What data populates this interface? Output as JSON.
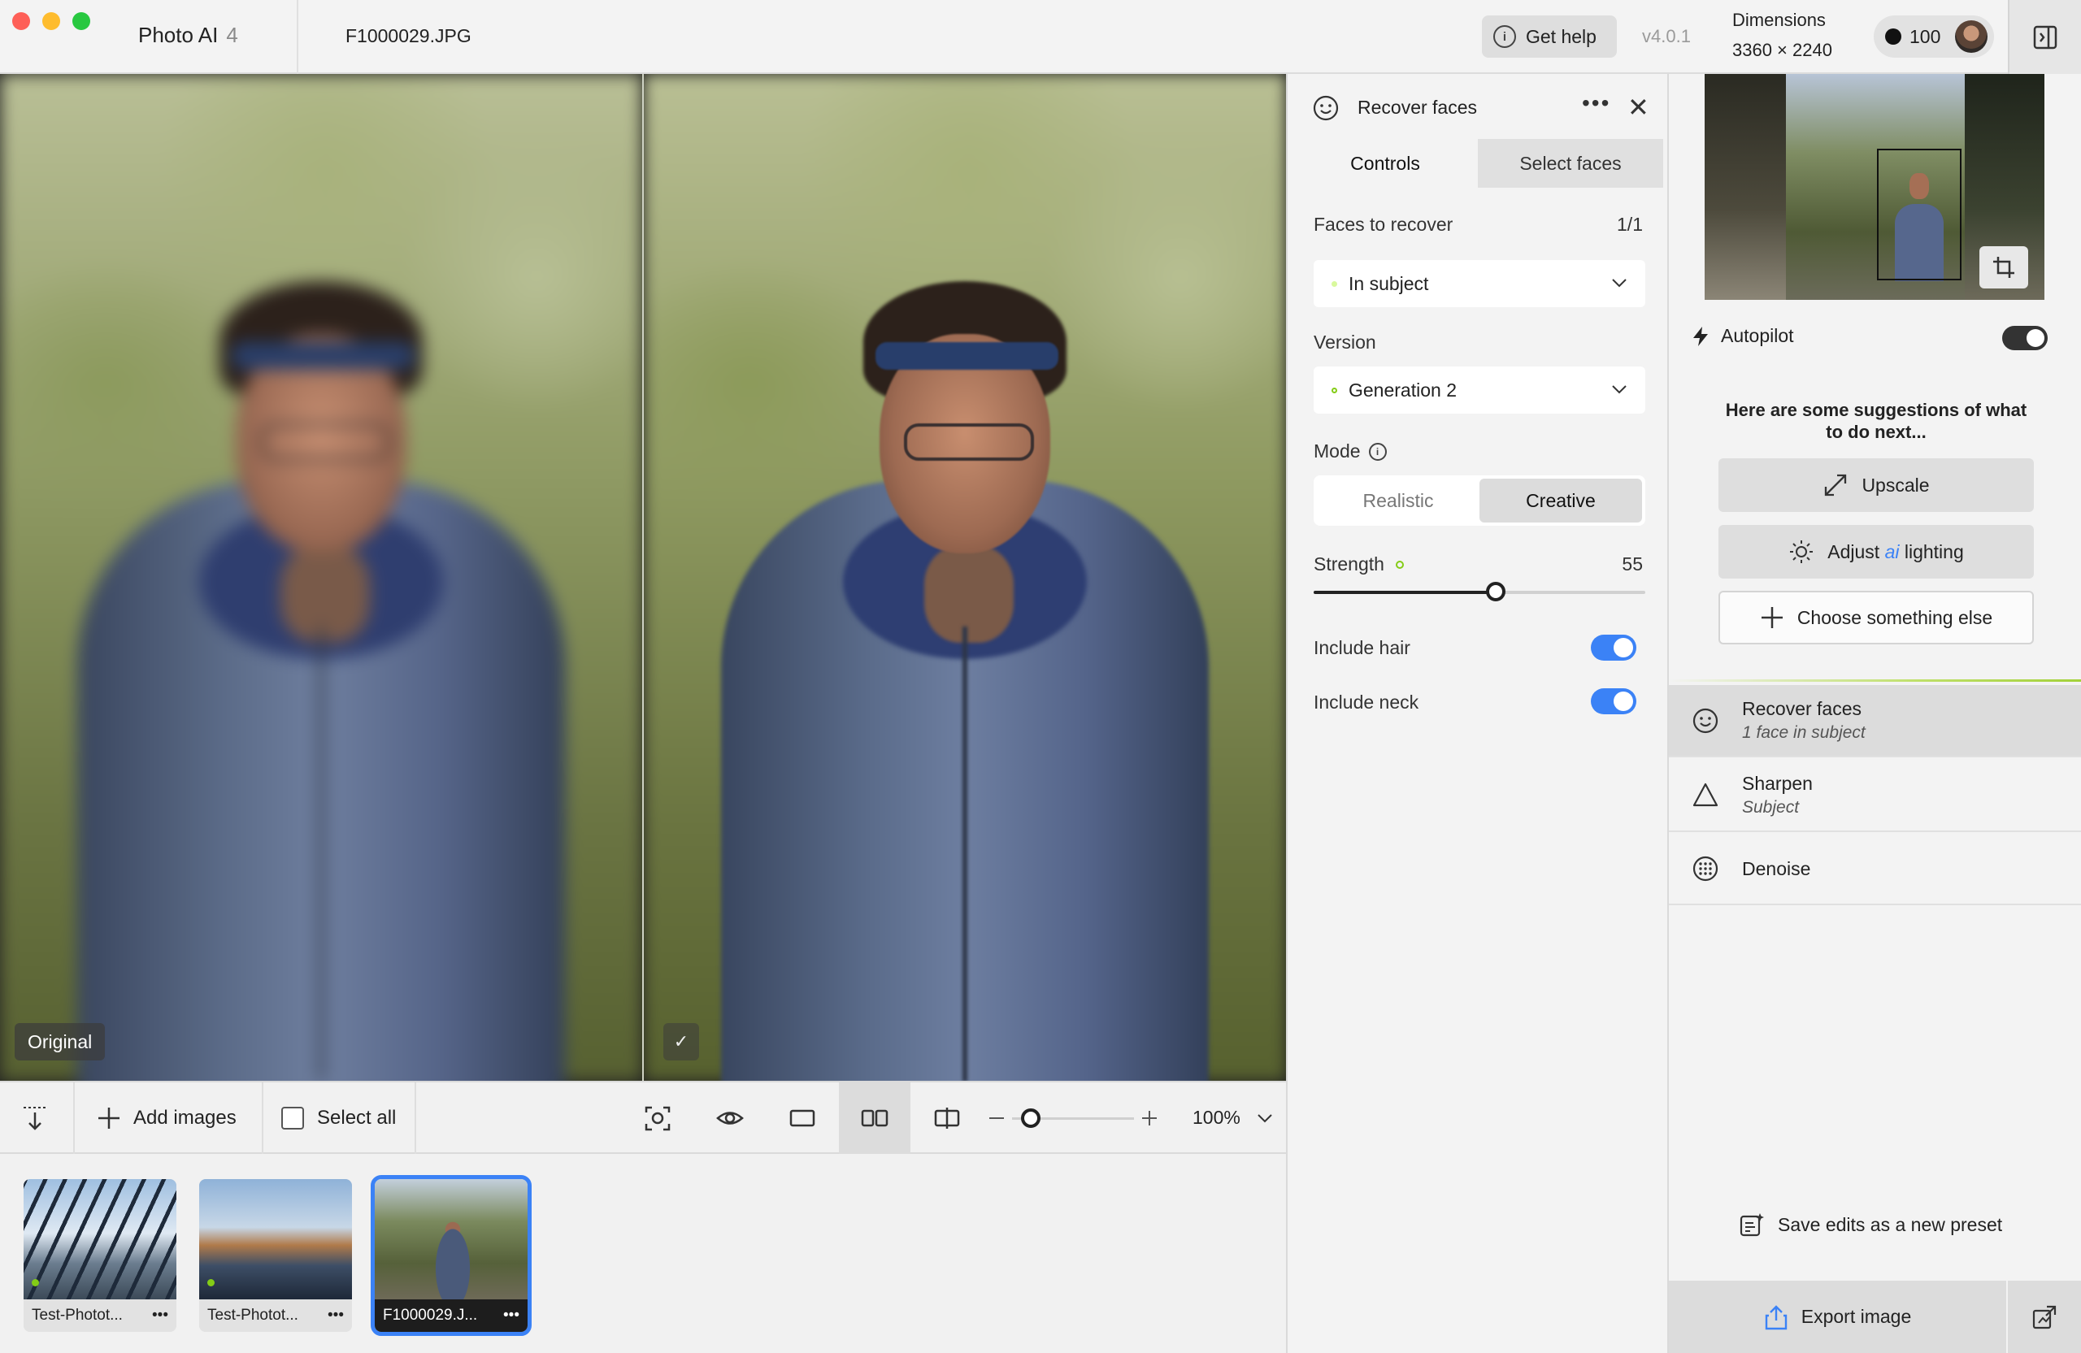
{
  "titlebar": {
    "app_name": "Photo AI",
    "app_version": "4",
    "file_name": "F1000029.JPG",
    "get_help": "Get help",
    "build_version": "v4.0.1",
    "dimensions_label": "Dimensions",
    "dimensions_value": "3360 × 2240",
    "credits": "100"
  },
  "canvas": {
    "original_tag": "Original",
    "processed_tag": "✓"
  },
  "toolbar": {
    "add_images": "Add images",
    "select_all": "Select all",
    "zoom_level": "100%",
    "zoom_fraction": 0.15
  },
  "filmstrip": [
    {
      "name": "Test-Photot...",
      "more": "•••",
      "selected": false
    },
    {
      "name": "Test-Photot...",
      "more": "•••",
      "selected": false
    },
    {
      "name": "F1000029.J...",
      "more": "•••",
      "selected": true
    }
  ],
  "panel": {
    "title": "Recover faces",
    "more": "•••",
    "close": "✕",
    "tabs": [
      "Controls",
      "Select faces"
    ],
    "faces_label": "Faces to recover",
    "faces_value": "1/1",
    "faces_dropdown": "In subject",
    "version_label": "Version",
    "version_dropdown": "Generation 2",
    "mode_label": "Mode",
    "mode_options": [
      "Realistic",
      "Creative"
    ],
    "mode_selected": "Creative",
    "strength_label": "Strength",
    "strength_value": "55",
    "strength_fraction": 0.55,
    "include_hair": "Include hair",
    "include_neck": "Include neck",
    "include_hair_on": true,
    "include_neck_on": true
  },
  "sidebar": {
    "autopilot": "Autopilot",
    "autopilot_on": true,
    "suggestions_title": "Here are some suggestions of what to do next...",
    "suggest_upscale": "Upscale",
    "suggest_adjust_pre": "Adjust",
    "suggest_adjust_ai": "ai",
    "suggest_adjust_post": "lighting",
    "suggest_other": "Choose something else",
    "enhancements": [
      {
        "name": "Recover faces",
        "sub": "1 face in subject",
        "icon": "smile-icon"
      },
      {
        "name": "Sharpen",
        "sub": "Subject",
        "icon": "triangle-icon"
      },
      {
        "name": "Denoise",
        "sub": "",
        "icon": "dotted-circle-icon"
      }
    ],
    "save_preset": "Save edits as a new preset",
    "export": "Export image"
  },
  "colors": {
    "accent": "#3b82f6",
    "green_dot": "#84cc16",
    "close_red": "#fe5f57",
    "min_yellow": "#febc2e",
    "max_green": "#28c840"
  }
}
